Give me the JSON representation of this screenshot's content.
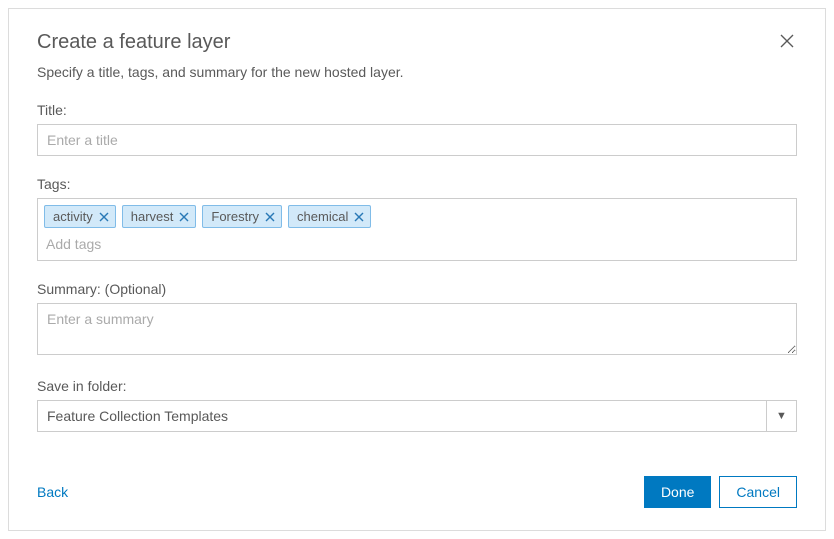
{
  "dialog": {
    "title": "Create a feature layer",
    "subtitle": "Specify a title, tags, and summary for the new hosted layer."
  },
  "fields": {
    "title": {
      "label": "Title:",
      "placeholder": "Enter a title",
      "value": ""
    },
    "tags": {
      "label": "Tags:",
      "placeholder": "Add tags",
      "chips": [
        "activity",
        "harvest",
        "Forestry",
        "chemical"
      ]
    },
    "summary": {
      "label": "Summary: (Optional)",
      "placeholder": "Enter a summary",
      "value": ""
    },
    "folder": {
      "label": "Save in folder:",
      "selected": "Feature Collection Templates"
    }
  },
  "footer": {
    "back": "Back",
    "done": "Done",
    "cancel": "Cancel"
  }
}
